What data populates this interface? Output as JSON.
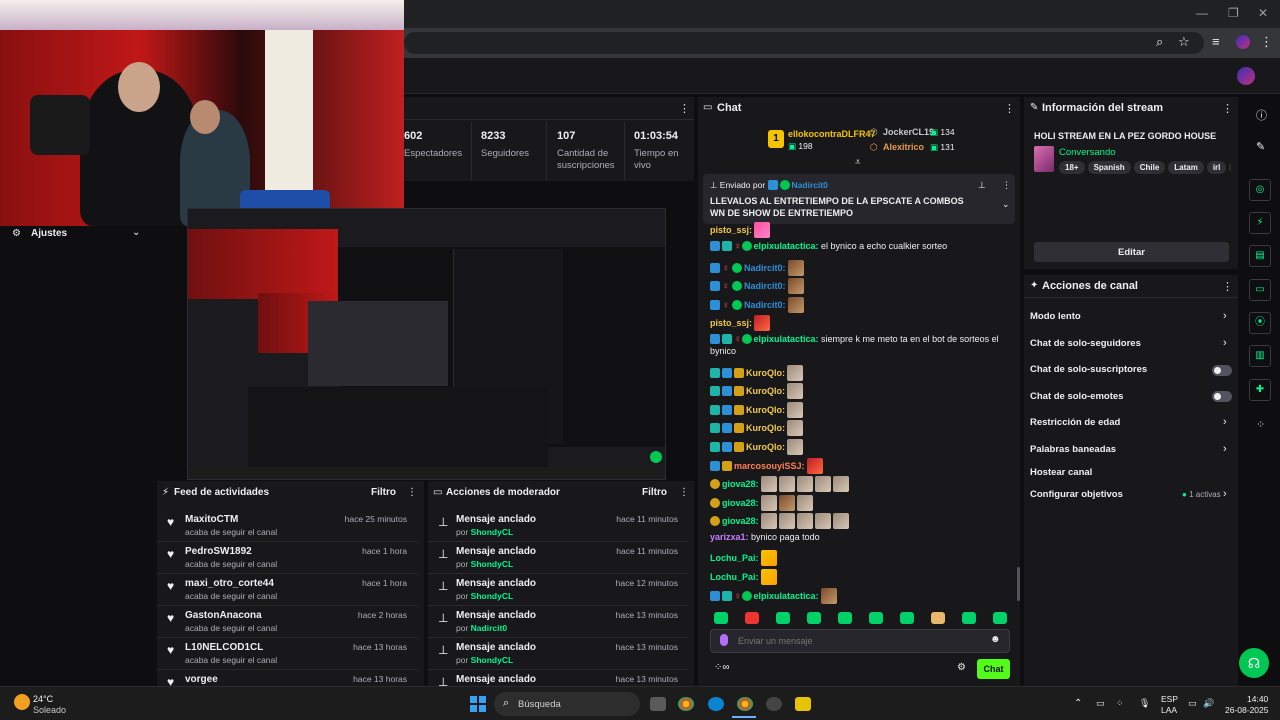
{
  "stats": [
    {
      "value": "602",
      "label": "Espectadores"
    },
    {
      "value": "8233",
      "label": "Seguidores"
    },
    {
      "value": "107",
      "label": "Cantidad de suscripciones"
    },
    {
      "value": "01:03:54",
      "label": "Tiempo en vivo"
    }
  ],
  "left": {
    "ajustes_label": "Ajustes"
  },
  "feed": {
    "title": "Feed de actividades",
    "filter_label": "Filtro",
    "items": [
      {
        "name": "MaxitoCTM",
        "action": "acaba de seguir el canal",
        "time": "hace 25 minutos"
      },
      {
        "name": "PedroSW1892",
        "action": "acaba de seguir el canal",
        "time": "hace 1 hora"
      },
      {
        "name": "maxi_otro_corte44",
        "action": "acaba de seguir el canal",
        "time": "hace 1 hora"
      },
      {
        "name": "GastonAnacona",
        "action": "acaba de seguir el canal",
        "time": "hace 2 horas"
      },
      {
        "name": "L10NELCOD1CL",
        "action": "acaba de seguir el canal",
        "time": "hace 13 horas"
      },
      {
        "name": "vorgee",
        "action": "",
        "time": "hace 13 horas"
      }
    ]
  },
  "mod": {
    "title": "Acciones de moderador",
    "filter_label": "Filtro",
    "items": [
      {
        "title": "Mensaje anclado",
        "by": "por",
        "user": "ShondyCL",
        "time": "hace 11 minutos"
      },
      {
        "title": "Mensaje anclado",
        "by": "por",
        "user": "ShondyCL",
        "time": "hace 11 minutos"
      },
      {
        "title": "Mensaje anclado",
        "by": "por",
        "user": "ShondyCL",
        "time": "hace 12 minutos"
      },
      {
        "title": "Mensaje anclado",
        "by": "por",
        "user": "Nadircit0",
        "time": "hace 13 minutos"
      },
      {
        "title": "Mensaje anclado",
        "by": "por",
        "user": "ShondyCL",
        "time": "hace 13 minutos"
      },
      {
        "title": "Mensaje anclado",
        "by": "",
        "user": "",
        "time": "hace 13 minutos"
      }
    ]
  },
  "chat": {
    "title": "Chat",
    "top_gifters": [
      {
        "name": "ellokocontraDLFR47",
        "count": "198"
      },
      {
        "name": "JockerCL19",
        "count": "134"
      },
      {
        "name": "Alexitrico",
        "count": "131"
      }
    ],
    "pinned": {
      "sent_by_label": "Enviado por",
      "sender": "Nadircit0",
      "message": "LLEVALOS AL ENTRETIEMPO DE LA EPSCATE A COMBOS WN DE SHOW DE ENTRETIEMPO"
    },
    "messages": [
      {
        "user": "pisto_ssj:",
        "text": "",
        "color": "#f2c94c"
      },
      {
        "user": "elpixulatactica:",
        "text": "el bynico a echo cualkier sorteo",
        "color": "#00f593"
      },
      {
        "user": "Nadircit0:",
        "text": "",
        "color": "#2d8fd5"
      },
      {
        "user": "Nadircit0:",
        "text": "",
        "color": "#2d8fd5"
      },
      {
        "user": "Nadircit0:",
        "text": "",
        "color": "#2d8fd5"
      },
      {
        "user": "pisto_ssj:",
        "text": "",
        "color": "#f2c94c"
      },
      {
        "user": "elpixulatactica:",
        "text": "siempre k me meto ta en el bot de sorteos el",
        "text2": "bynico",
        "color": "#00f593"
      },
      {
        "user": "KuroQlo:",
        "text": "",
        "color": "#f2c94c"
      },
      {
        "user": "KuroQlo:",
        "text": "",
        "color": "#f2c94c"
      },
      {
        "user": "KuroQlo:",
        "text": "",
        "color": "#f2c94c"
      },
      {
        "user": "KuroQlo:",
        "text": "",
        "color": "#f2c94c"
      },
      {
        "user": "KuroQlo:",
        "text": "",
        "color": "#f2c94c"
      },
      {
        "user": "marcosouyiSSJ:",
        "text": "",
        "color": "#ff7f50"
      },
      {
        "user": "giova28:",
        "text": "",
        "color": "#00f593"
      },
      {
        "user": "giova28:",
        "text": "",
        "color": "#00f593"
      },
      {
        "user": "giova28:",
        "text": "",
        "color": "#00f593"
      },
      {
        "user": "yarizxa1:",
        "text": "bynico paga todo",
        "color": "#c77dff"
      },
      {
        "user": "Lochu_Pai:",
        "text": "",
        "color": "#00f593"
      },
      {
        "user": "Lochu_Pai:",
        "text": "",
        "color": "#00f593"
      },
      {
        "user": "elpixulatactica:",
        "text": "",
        "color": "#00f593"
      }
    ],
    "input_placeholder": "Enviar un mensaje",
    "send_label": "Chat"
  },
  "info": {
    "title": "Información del stream",
    "stream_title": "HOLI STREAM EN LA PEZ GORDO HOUSE",
    "category": "Conversando",
    "tags": [
      "18+",
      "Spanish",
      "Chile",
      "Latam",
      "irl",
      "ub"
    ],
    "edit_label": "Editar"
  },
  "channel_actions": {
    "title": "Acciones de canal",
    "items": [
      {
        "label": "Modo lento",
        "control": "chevron"
      },
      {
        "label": "Chat de solo-seguidores",
        "control": "chevron"
      },
      {
        "label": "Chat de solo-suscriptores",
        "control": "toggle"
      },
      {
        "label": "Chat de solo-emotes",
        "control": "toggle"
      },
      {
        "label": "Restricción de edad",
        "control": "chevron"
      },
      {
        "label": "Palabras baneadas",
        "control": "chevron"
      },
      {
        "label": "Hostear canal",
        "control": "none"
      },
      {
        "label": "Configurar objetivos",
        "control": "chevron",
        "extra": "1 activas"
      }
    ]
  },
  "taskbar": {
    "weather_temp": "24°C",
    "weather_desc": "Soleado",
    "search_label": "Búsqueda",
    "lang": "ESP",
    "lang2": "LAA",
    "time": "14:40",
    "date": "26-08-2025"
  },
  "colors": {
    "accent": "#00f593",
    "panel": "#18181b",
    "bg": "#0e0e10"
  }
}
